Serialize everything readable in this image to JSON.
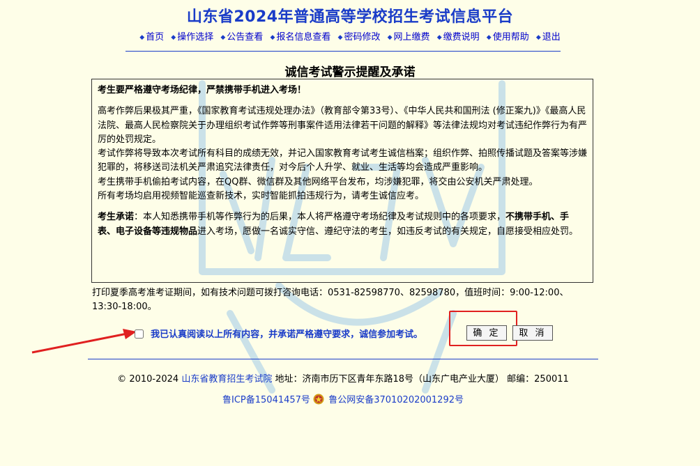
{
  "header": {
    "title": "山东省2024年普通高等学校招生考试信息平台"
  },
  "nav": {
    "items": [
      {
        "label": "首页"
      },
      {
        "label": "操作选择"
      },
      {
        "label": "公告查看"
      },
      {
        "label": "报名信息查看"
      },
      {
        "label": "密码修改"
      },
      {
        "label": "网上缴费"
      },
      {
        "label": "缴费说明"
      },
      {
        "label": "使用帮助"
      },
      {
        "label": "退出"
      }
    ]
  },
  "notice": {
    "title": "诚信考试警示提醒及承诺",
    "heading": "考生要严格遵守考场纪律，严禁携带手机进入考场！",
    "para1": "高考作弊后果极其严重，《国家教育考试违规处理办法》（教育部令第33号）、《中华人民共和国刑法 (修正案九)》《最高人民法院、最高人民检察院关于办理组织考试作弊等刑事案件适用法律若干问题的解释》等法律法规均对考试违纪作弊行为有严厉的处罚规定。",
    "para2": "考试作弊将导致本次考试所有科目的成绩无效，并记入国家教育考试考生诚信档案；组织作弊、拍照传播试题及答案等涉嫌犯罪的，将移送司法机关严肃追究法律责任，对今后个人升学、就业、生活等均会造成严重影响。",
    "para3": "考生携带手机偷拍考试内容，在QQ群、微信群及其他网络平台发布，均涉嫌犯罪，将交由公安机关严肃处理。",
    "para4": "所有考场均启用视频智能巡查新技术，实时智能抓拍违规行为，请考生诚信应考。",
    "pledge_label": "考生承诺",
    "pledge_part1": "：本人知悉携带手机等作弊行为的后果，本人将严格遵守考场纪律及考试规则中的各项要求，",
    "pledge_bold": "不携带手机、手表、电子设备等违规物品",
    "pledge_part2": "进入考场，愿做一名诚实守信、遵纪守法的考生，如违反考试的有关规定，自愿接受相应处罚。"
  },
  "help_text": "打印夏季高考准考证期间，如有技术问题可拨打咨询电话：0531-82598770、82598780，值班时间：9:00-12:00、13:30-18:00。",
  "agree": {
    "label": "我已认真阅读以上所有内容，并承诺严格遵守要求，诚信参加考试。",
    "checked": false
  },
  "buttons": {
    "ok": "确 定",
    "cancel": "取 消"
  },
  "footer": {
    "copyright": "© 2010-2024",
    "org_link": "山东省教育招生考试院",
    "address": "地址：济南市历下区青年东路18号（山东广电产业大厦） 邮编：250011",
    "icp": "鲁ICP备15041457号",
    "police": "鲁公网安备37010202001292号"
  },
  "colors": {
    "accent": "#1a3cc8",
    "background": "#fefee8",
    "highlight": "#e02020"
  }
}
